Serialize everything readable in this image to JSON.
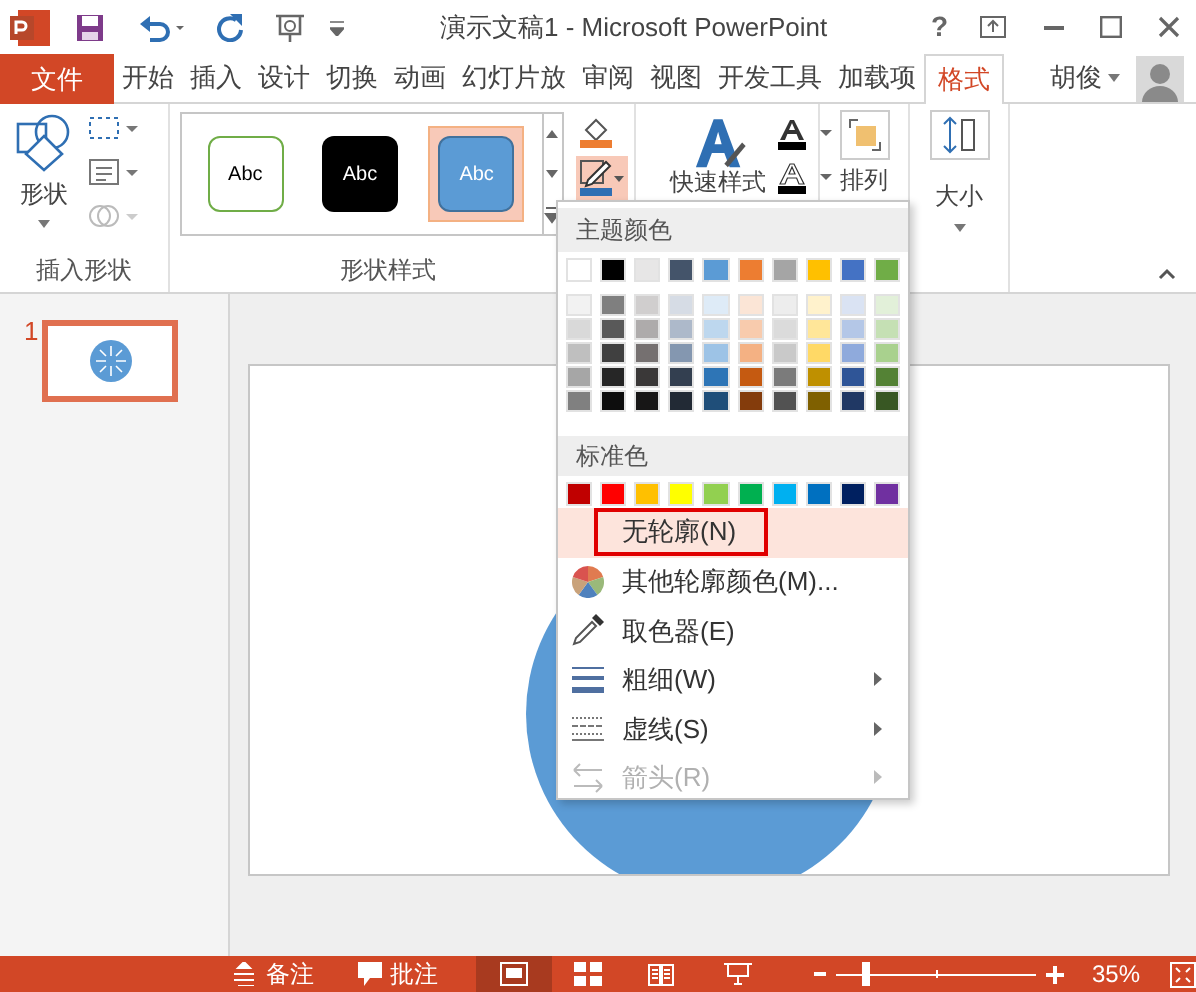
{
  "window": {
    "title": "演示文稿1 - Microsoft PowerPoint",
    "help": "?"
  },
  "tabs": [
    {
      "label": "文件",
      "kind": "file",
      "selected": false
    },
    {
      "label": "开始",
      "kind": "tab",
      "selected": false
    },
    {
      "label": "插入",
      "kind": "tab",
      "selected": false
    },
    {
      "label": "设计",
      "kind": "tab",
      "selected": false
    },
    {
      "label": "切换",
      "kind": "tab",
      "selected": false
    },
    {
      "label": "动画",
      "kind": "tab",
      "selected": false
    },
    {
      "label": "幻灯片放",
      "kind": "tab",
      "selected": false
    },
    {
      "label": "审阅",
      "kind": "tab",
      "selected": false
    },
    {
      "label": "视图",
      "kind": "tab",
      "selected": false
    },
    {
      "label": "开发工具",
      "kind": "tab",
      "selected": false
    },
    {
      "label": "加载项",
      "kind": "tab",
      "selected": false
    },
    {
      "label": "格式",
      "kind": "tab",
      "selected": true
    }
  ],
  "account": {
    "name": "胡俊"
  },
  "ribbon": {
    "insert_shapes": {
      "label": "插入形状",
      "shapes": "形状"
    },
    "shape_styles": {
      "label": "形状样式",
      "outline_open": true,
      "styles": [
        {
          "text": "Abc",
          "kind": "outlined",
          "selected": false
        },
        {
          "text": "Abc",
          "kind": "dark",
          "selected": false
        },
        {
          "text": "Abc",
          "kind": "accent",
          "selected": true
        }
      ]
    },
    "wordart": {
      "quick_styles": "快速样式"
    },
    "arrange": "排列",
    "size": "大小"
  },
  "slides": [
    {
      "number": "1",
      "selected": true
    }
  ],
  "outline_menu": {
    "theme_header": "主题颜色",
    "theme_colors": [
      {
        "color": "#ffffff",
        "shades": [
          {
            "color": "#f2f2f2"
          },
          {
            "color": "#d9d9d9"
          },
          {
            "color": "#bfbfbf"
          },
          {
            "color": "#a6a6a6"
          },
          {
            "color": "#808080"
          }
        ]
      },
      {
        "color": "#000000",
        "shades": [
          {
            "color": "#7f7f7f"
          },
          {
            "color": "#595959"
          },
          {
            "color": "#404040"
          },
          {
            "color": "#262626"
          },
          {
            "color": "#0d0d0d"
          }
        ]
      },
      {
        "color": "#e7e6e6",
        "shades": [
          {
            "color": "#d0cece"
          },
          {
            "color": "#aeabab"
          },
          {
            "color": "#757070"
          },
          {
            "color": "#3a3838"
          },
          {
            "color": "#171616"
          }
        ]
      },
      {
        "color": "#44546a",
        "shades": [
          {
            "color": "#d6dce5"
          },
          {
            "color": "#adb9ca"
          },
          {
            "color": "#8497b0"
          },
          {
            "color": "#333f50"
          },
          {
            "color": "#222a35"
          }
        ]
      },
      {
        "color": "#5b9bd5",
        "shades": [
          {
            "color": "#deebf7"
          },
          {
            "color": "#bdd7ee"
          },
          {
            "color": "#9dc3e6"
          },
          {
            "color": "#2e75b6"
          },
          {
            "color": "#1f4e79"
          }
        ]
      },
      {
        "color": "#ed7d31",
        "shades": [
          {
            "color": "#fbe5d6"
          },
          {
            "color": "#f8cbad"
          },
          {
            "color": "#f4b183"
          },
          {
            "color": "#c55a11"
          },
          {
            "color": "#843c0c"
          }
        ]
      },
      {
        "color": "#a5a5a5",
        "shades": [
          {
            "color": "#ededed"
          },
          {
            "color": "#dbdbdb"
          },
          {
            "color": "#c9c9c9"
          },
          {
            "color": "#7b7b7b"
          },
          {
            "color": "#525252"
          }
        ]
      },
      {
        "color": "#ffc000",
        "shades": [
          {
            "color": "#fff2cc"
          },
          {
            "color": "#ffe699"
          },
          {
            "color": "#ffd966"
          },
          {
            "color": "#bf9000"
          },
          {
            "color": "#7f6000"
          }
        ]
      },
      {
        "color": "#4472c4",
        "shades": [
          {
            "color": "#dae3f3"
          },
          {
            "color": "#b4c7e7"
          },
          {
            "color": "#8faadc"
          },
          {
            "color": "#2f5597"
          },
          {
            "color": "#203864"
          }
        ]
      },
      {
        "color": "#70ad47",
        "shades": [
          {
            "color": "#e2f0d9"
          },
          {
            "color": "#c5e0b4"
          },
          {
            "color": "#a9d18e"
          },
          {
            "color": "#548235"
          },
          {
            "color": "#385723"
          }
        ]
      }
    ],
    "standard_header": "标准色",
    "standard_colors": [
      {
        "color": "#c00000"
      },
      {
        "color": "#ff0000"
      },
      {
        "color": "#ffc000"
      },
      {
        "color": "#ffff00"
      },
      {
        "color": "#92d050"
      },
      {
        "color": "#00b050"
      },
      {
        "color": "#00b0f0"
      },
      {
        "color": "#0070c0"
      },
      {
        "color": "#002060"
      },
      {
        "color": "#7030a0"
      }
    ],
    "items": [
      {
        "label": "无轮廓(N)",
        "kind": "none",
        "selected": true,
        "submenu": false,
        "disabled": false
      },
      {
        "label": "其他轮廓颜色(M)...",
        "kind": "palette",
        "selected": false,
        "submenu": false,
        "disabled": false
      },
      {
        "label": "取色器(E)",
        "kind": "eyedropper",
        "selected": false,
        "submenu": false,
        "disabled": false
      },
      {
        "label": "粗细(W)",
        "kind": "weight",
        "selected": false,
        "submenu": true,
        "disabled": false
      },
      {
        "label": "虚线(S)",
        "kind": "dashes",
        "selected": false,
        "submenu": true,
        "disabled": false
      },
      {
        "label": "箭头(R)",
        "kind": "arrows",
        "selected": false,
        "submenu": true,
        "disabled": true
      }
    ]
  },
  "status_bar": {
    "notes": "备注",
    "comments": "批注",
    "views": [
      {
        "kind": "normal",
        "selected": true
      },
      {
        "kind": "sorter",
        "selected": false
      },
      {
        "kind": "reading",
        "selected": false
      },
      {
        "kind": "show",
        "selected": false
      }
    ],
    "zoom": {
      "level": 0.15,
      "reading": "35%"
    }
  }
}
